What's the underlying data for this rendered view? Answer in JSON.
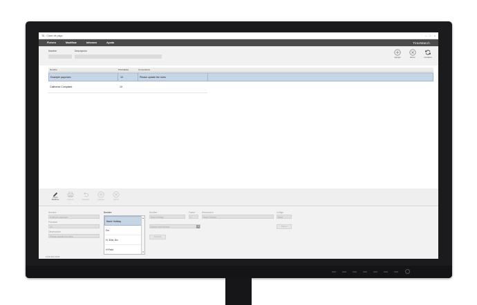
{
  "window": {
    "title": "TA - Clave de pago"
  },
  "menu": {
    "items": [
      "Fichero",
      "Modificar",
      "Informes",
      "Ayuda"
    ],
    "brand": "TimeWatch"
  },
  "header": {
    "nombre_label": "Nombre",
    "descripcion_label": "Descripción"
  },
  "top_actions": [
    {
      "label": "Agregar",
      "icon": "plus-circle-icon"
    },
    {
      "label": "Borrar",
      "icon": "x-circle-icon"
    },
    {
      "label": "Actualizar",
      "icon": "refresh-icon"
    }
  ],
  "grid": {
    "columns": [
      "Nombre",
      "Prioridades",
      "Comentarios"
    ],
    "rows": [
      {
        "nombre": "Example paycharc",
        "prioridad": "10",
        "comentario": "Please update the rules",
        "selected": true
      },
      {
        "nombre": "California Compliant",
        "prioridad": "10",
        "comentario": "",
        "selected": false
      }
    ]
  },
  "toolbar": [
    {
      "label": "Modificar",
      "icon": "edit-icon",
      "enabled": true
    },
    {
      "label": "Imprimir",
      "icon": "print-icon",
      "enabled": false
    },
    {
      "label": "Deshacer",
      "icon": "undo-icon",
      "enabled": false
    },
    {
      "label": "Agregar",
      "icon": "plus-circle-icon",
      "enabled": false
    },
    {
      "label": "Cerrar",
      "icon": "x-circle-icon",
      "enabled": false
    }
  ],
  "form": {
    "nombre_label": "Nombre",
    "nombre_value": "Example paycharc",
    "prioridad_label": "Prioridad",
    "prioridad_value": "10",
    "observacion_label": "Observación",
    "observacion_value": "Please update the rules",
    "list_label": "Nombre",
    "list_items": [
      "Bank Holiday",
      "Do",
      "H. Extr. Do.",
      "H.Fest."
    ],
    "sub_nombre_label": "Nombre",
    "sub_nombre_value": "Bank Holiday",
    "factor_label": "Factor",
    "factor_value": "1",
    "descripcion_label": "Descripción",
    "descripcion_value": "Bank Holiday",
    "codigo_label": "Código",
    "codigo_value": "Bank",
    "select_value": "Desde una fórmula",
    "formula_button": "Fórmula",
    "borrar_button": "Borrar"
  },
  "status": {
    "text": "12.34.2019 15:06"
  }
}
